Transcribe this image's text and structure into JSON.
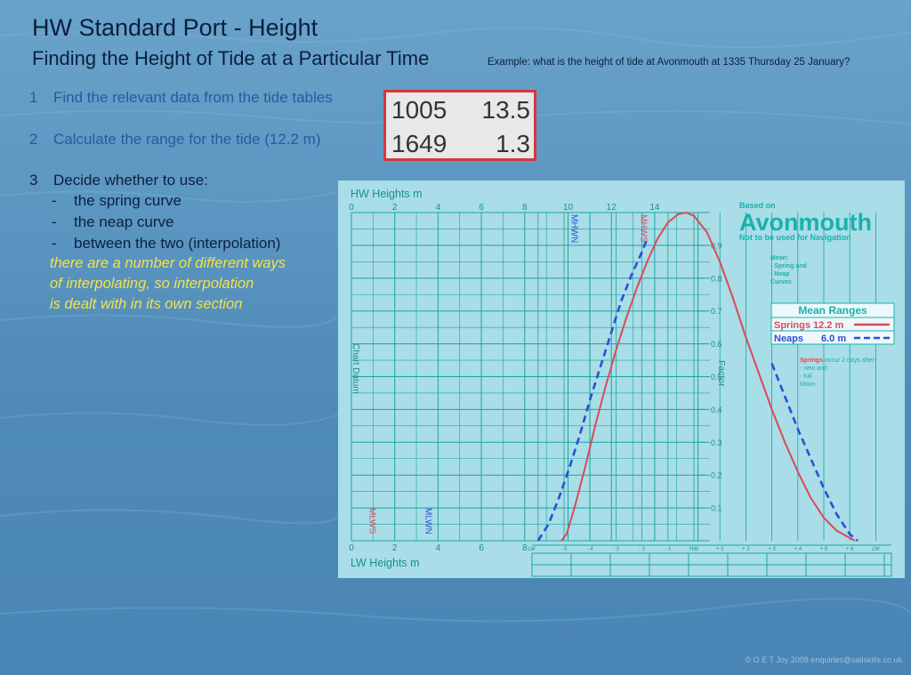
{
  "title": "HW Standard Port - Height",
  "subtitle": "Finding  the Height of Tide at a Particular Time",
  "example": "Example:  what is the height of tide at Avonmouth at 1335 Thursday 25 January?",
  "steps": [
    {
      "num": "1",
      "text": "Find the relevant data from the tide tables"
    },
    {
      "num": "2",
      "text": "Calculate the range for the tide (12.2 m)"
    },
    {
      "num": "3",
      "text": "Decide whether to use:"
    }
  ],
  "options": [
    "the spring curve",
    "the neap curve",
    "between the two (interpolation)"
  ],
  "option_dash": "-",
  "note_lines": [
    "there are a number of different ways",
    "of interpolating, so interpolation",
    "is dealt with in its own section"
  ],
  "tide_data": [
    {
      "time": "1005",
      "height": "13.5"
    },
    {
      "time": "1649",
      "height": "1.3"
    }
  ],
  "copyright": "© O E T Joy 2008 enquiries@sailskills.co.uk",
  "colors": {
    "springs": "#d94a5a",
    "neaps": "#2b4fd6",
    "grid": "#1aa6a0",
    "panel": "#a9dde7",
    "title_teal": "#19b2ad"
  },
  "chart_data": {
    "type": "line",
    "hw_axis_label": "HW Heights m",
    "lw_axis_label": "LW Heights m",
    "hw_ticks": [
      "0",
      "2",
      "4",
      "6",
      "8",
      "10",
      "12",
      "14"
    ],
    "lw_ticks": [
      "0",
      "2",
      "4",
      "6",
      "8"
    ],
    "chart_datum_label": "Chart Datum",
    "factor_label": "Factor",
    "factor_ticks": [
      "0.9",
      "0.8",
      "0.7",
      "0.6",
      "0.5",
      "0.4",
      "0.3",
      "0.2",
      "0.1"
    ],
    "time_ticks": [
      "LW",
      "- 5",
      "- 4",
      "- 3",
      "- 2",
      "- 1",
      "HW",
      "+ 1",
      "+ 2",
      "+ 3",
      "+ 4",
      "+ 5",
      "+ 6",
      "LW"
    ],
    "hw_markers": [
      {
        "label": "MHWN",
        "value": 10,
        "color": "#2b4fd6"
      },
      {
        "label": "MHWS",
        "value": 13.2,
        "color": "#d94a5a"
      }
    ],
    "lw_markers": [
      {
        "label": "MLWS",
        "value": 1,
        "color": "#d94a5a"
      },
      {
        "label": "MLWN",
        "value": 3.6,
        "color": "#2b4fd6"
      }
    ],
    "based_on": "Based on",
    "port": "Avonmouth",
    "port_note": "Not to be used for Navigation",
    "mean_note": [
      "Mean:",
      "-  Spring and",
      "-  Neap",
      "Curves"
    ],
    "mean_ranges_title": "Mean Ranges",
    "mean_ranges": [
      {
        "name": "Springs",
        "value": "12.2 m",
        "style": "solid"
      },
      {
        "name": "Neaps",
        "value": "6.0 m",
        "style": "dashed"
      }
    ],
    "springs_note": [
      "Springs occur 2 days after:",
      "-  new and",
      "-  full",
      "Moon"
    ],
    "series": [
      {
        "name": "Springs",
        "style": "solid",
        "points": [
          [
            -5.1,
            0.0
          ],
          [
            -4.9,
            0.02
          ],
          [
            -4.6,
            0.1
          ],
          [
            -4.2,
            0.22
          ],
          [
            -3.8,
            0.35
          ],
          [
            -3.4,
            0.47
          ],
          [
            -3.0,
            0.58
          ],
          [
            -2.6,
            0.68
          ],
          [
            -2.2,
            0.77
          ],
          [
            -1.8,
            0.85
          ],
          [
            -1.4,
            0.92
          ],
          [
            -1.0,
            0.97
          ],
          [
            -0.6,
            0.995
          ],
          [
            -0.3,
            1.0
          ],
          [
            0.0,
            0.99
          ],
          [
            0.5,
            0.94
          ],
          [
            1.0,
            0.85
          ],
          [
            1.5,
            0.74
          ],
          [
            2.0,
            0.62
          ],
          [
            2.5,
            0.51
          ],
          [
            3.0,
            0.4
          ],
          [
            3.5,
            0.3
          ],
          [
            4.0,
            0.21
          ],
          [
            4.5,
            0.13
          ],
          [
            5.0,
            0.07
          ],
          [
            5.5,
            0.03
          ],
          [
            6.2,
            0.0
          ]
        ]
      },
      {
        "name": "Neaps",
        "style": "dashed",
        "points": [
          [
            -6.0,
            0.0
          ],
          [
            -5.6,
            0.05
          ],
          [
            -5.2,
            0.13
          ],
          [
            -4.8,
            0.22
          ],
          [
            -4.4,
            0.32
          ],
          [
            -4.0,
            0.43
          ],
          [
            -3.6,
            0.53
          ],
          [
            -3.2,
            0.63
          ],
          [
            -2.8,
            0.73
          ],
          [
            -2.4,
            0.81
          ],
          [
            -2.0,
            0.88
          ],
          [
            -1.8,
            0.92
          ]
        ]
      },
      {
        "name": "Neaps ebb",
        "style": "dashed",
        "points": [
          [
            3.0,
            0.54
          ],
          [
            3.5,
            0.44
          ],
          [
            4.0,
            0.34
          ],
          [
            4.5,
            0.25
          ],
          [
            5.0,
            0.16
          ],
          [
            5.5,
            0.08
          ],
          [
            6.0,
            0.02
          ],
          [
            6.3,
            0.0
          ]
        ]
      }
    ]
  }
}
